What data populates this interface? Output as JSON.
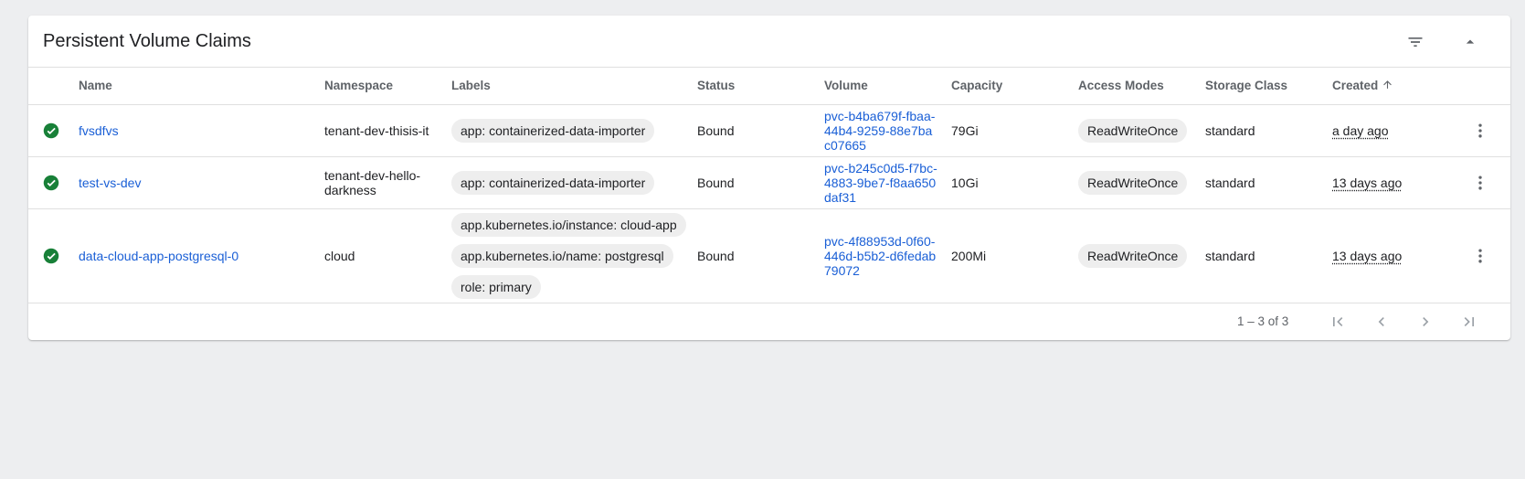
{
  "card": {
    "title": "Persistent Volume Claims",
    "filter_icon": "filter-list-icon",
    "collapse_icon": "arrow-drop-up-icon"
  },
  "columns": {
    "name": "Name",
    "namespace": "Namespace",
    "labels": "Labels",
    "status": "Status",
    "volume": "Volume",
    "capacity": "Capacity",
    "access_modes": "Access Modes",
    "storage_class": "Storage Class",
    "created": "Created",
    "created_sort": "ascending"
  },
  "rows": [
    {
      "status_icon": "check-circle-icon",
      "name": "fvsdfvs",
      "namespace": "tenant-dev-thisis-it",
      "labels": [
        "app: containerized-data-importer"
      ],
      "status": "Bound",
      "volume": "pvc-b4ba679f-fbaa-44b4-9259-88e7bac07665",
      "capacity": "79Gi",
      "access_mode": "ReadWriteOnce",
      "storage_class": "standard",
      "created": "a day ago"
    },
    {
      "status_icon": "check-circle-icon",
      "name": "test-vs-dev",
      "namespace": "tenant-dev-hello-darkness",
      "labels": [
        "app: containerized-data-importer"
      ],
      "status": "Bound",
      "volume": "pvc-b245c0d5-f7bc-4883-9be7-f8aa650daf31",
      "capacity": "10Gi",
      "access_mode": "ReadWriteOnce",
      "storage_class": "standard",
      "created": "13 days ago"
    },
    {
      "status_icon": "check-circle-icon",
      "name": "data-cloud-app-postgresql-0",
      "namespace": "cloud",
      "labels": [
        "app.kubernetes.io/instance: cloud-app",
        "app.kubernetes.io/name: postgresql",
        "role: primary"
      ],
      "status": "Bound",
      "volume": "pvc-4f88953d-0f60-446d-b5b2-d6fedab79072",
      "capacity": "200Mi",
      "access_mode": "ReadWriteOnce",
      "storage_class": "standard",
      "created": "13 days ago"
    }
  ],
  "pagination": {
    "range_label": "1 – 3 of 3"
  },
  "colors": {
    "link": "#1a5fd6",
    "success": "#188038",
    "chip": "#eeeeee"
  }
}
